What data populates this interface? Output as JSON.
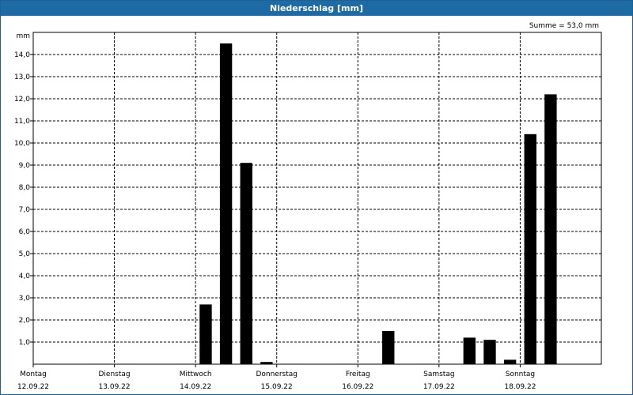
{
  "title": "Niederschlag [mm]",
  "summary": "Summe = 53,0 mm",
  "chart_data": {
    "type": "bar",
    "title": "Niederschlag [mm]",
    "ylabel": "mm",
    "ylim": [
      0,
      15
    ],
    "yticks": [
      "1,0",
      "2,0",
      "3,0",
      "4,0",
      "5,0",
      "6,0",
      "7,0",
      "8,0",
      "9,0",
      "10,0",
      "11,0",
      "12,0",
      "13,0",
      "14,0"
    ],
    "grid": true,
    "days": [
      {
        "day": "Montag",
        "date": "12.09.22"
      },
      {
        "day": "Dienstag",
        "date": "13.09.22"
      },
      {
        "day": "Mittwoch",
        "date": "14.09.22"
      },
      {
        "day": "Donnerstag",
        "date": "15.09.22"
      },
      {
        "day": "Freitag",
        "date": "16.09.22"
      },
      {
        "day": "Samstag",
        "date": "17.09.22"
      },
      {
        "day": "Sonntag",
        "date": "18.09.22"
      }
    ],
    "interval_hours": 6,
    "values": [
      0,
      0,
      0,
      0,
      0,
      0,
      0,
      0,
      2.7,
      14.5,
      9.1,
      0.1,
      0,
      0,
      0,
      0,
      0,
      1.5,
      0,
      0,
      0,
      1.2,
      1.1,
      0.2,
      10.4,
      12.2
    ],
    "bar_color": "#000000"
  }
}
